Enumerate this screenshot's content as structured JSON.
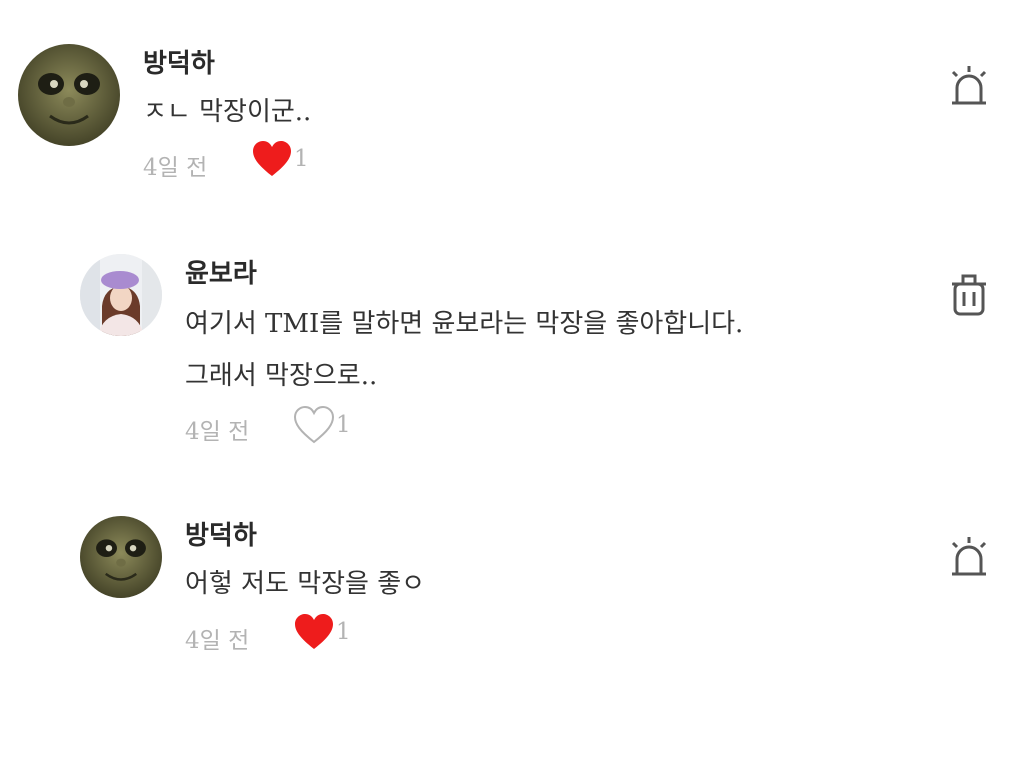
{
  "comments": [
    {
      "author": "방덕하",
      "lines": [
        "ㅈㄴ 막장이군.."
      ],
      "time": "4일 전",
      "liked": true,
      "like_count": "1",
      "action": "report-siren",
      "avatar": "tank-engine-face"
    },
    {
      "author": "윤보라",
      "lines": [
        "여기서 TMI를 말하면 윤보라는 막장을 좋아합니다.",
        "그래서 막장으로.."
      ],
      "time": "4일 전",
      "liked": false,
      "like_count": "1",
      "action": "delete-trash",
      "avatar": "person-photo"
    },
    {
      "author": "방덕하",
      "lines": [
        "어헣 저도 막장을 좋ㅇ"
      ],
      "time": "4일 전",
      "liked": true,
      "like_count": "1",
      "action": "report-siren",
      "avatar": "tank-engine-face"
    }
  ],
  "colors": {
    "heart_red": "#ee1c1c",
    "muted": "#b3b3b3",
    "icon": "#555555"
  }
}
